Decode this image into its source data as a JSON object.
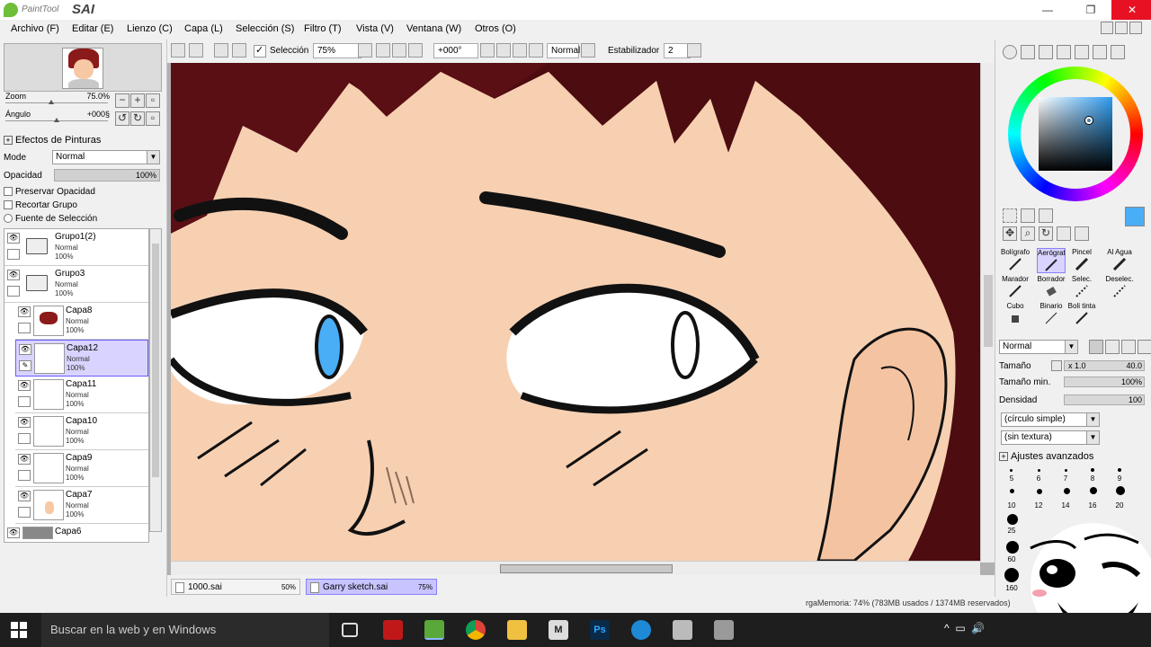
{
  "app": {
    "logo_small": "PaintTool",
    "logo_big": "SAI"
  },
  "window_controls": {
    "minimize": "—",
    "maximize": "❐",
    "close": "✕"
  },
  "menu": [
    "Archivo (F)",
    "Editar (E)",
    "Lienzo (C)",
    "Capa (L)",
    "Selección (S)",
    "Filtro (T)",
    "Vista (V)",
    "Ventana (W)",
    "Otros (O)"
  ],
  "navigator": {
    "zoom_label": "Zoom",
    "zoom_value": "75.0%",
    "angle_label": "Ángulo",
    "angle_value": "+000§"
  },
  "layer_props": {
    "effects_title": "Efectos de Pinturas",
    "mode_label": "Mode",
    "mode_value": "Normal",
    "opacity_label": "Opacidad",
    "opacity_value": "100%",
    "preserve_opacity": "Preservar Opacidad",
    "clip_group": "Recortar Grupo",
    "selection_source": "Fuente de Selección"
  },
  "layers": [
    {
      "name": "Grupo1(2)",
      "mode": "Normal",
      "opacity": "100%",
      "kind": "folder"
    },
    {
      "name": "Grupo3",
      "mode": "Normal",
      "opacity": "100%",
      "kind": "folder"
    },
    {
      "name": "Capa8",
      "mode": "Normal",
      "opacity": "100%",
      "kind": "layer"
    },
    {
      "name": "Capa12",
      "mode": "Normal",
      "opacity": "100%",
      "kind": "layer",
      "selected": true
    },
    {
      "name": "Capa11",
      "mode": "Normal",
      "opacity": "100%",
      "kind": "layer"
    },
    {
      "name": "Capa10",
      "mode": "Normal",
      "opacity": "100%",
      "kind": "layer"
    },
    {
      "name": "Capa9",
      "mode": "Normal",
      "opacity": "100%",
      "kind": "layer"
    },
    {
      "name": "Capa7",
      "mode": "Normal",
      "opacity": "100%",
      "kind": "layer"
    },
    {
      "name": "Capa6",
      "mode": "",
      "opacity": "",
      "kind": "layer"
    }
  ],
  "toolbar": {
    "selection_label": "Selección",
    "zoom_value": "75%",
    "angle_value": "+000°",
    "blend_mode": "Normal",
    "stabilizer_label": "Estabilizador",
    "stabilizer_value": "2"
  },
  "documents": [
    {
      "name": "1000.sai",
      "zoom": "50%",
      "active": false
    },
    {
      "name": "Garry sketch.sai",
      "zoom": "75%",
      "active": true
    }
  ],
  "tools": [
    {
      "label": "Bolígrafo"
    },
    {
      "label": "Aerógraf",
      "selected": true
    },
    {
      "label": "Pincel"
    },
    {
      "label": "Al Agua"
    },
    {
      "label": "Marador"
    },
    {
      "label": "Borrador"
    },
    {
      "label": "Selec."
    },
    {
      "label": "Deselec."
    },
    {
      "label": "Cubo"
    },
    {
      "label": "Binario"
    },
    {
      "label": "Boli tinta"
    }
  ],
  "brush": {
    "mode": "Normal",
    "size_label": "Tamaño",
    "size_mult": "x 1.0",
    "size_value": "40.0",
    "min_size_label": "Tamaño min.",
    "min_size_value": "100%",
    "density_label": "Densidad",
    "density_value": "100",
    "shape": "(círculo simple)",
    "texture": "(sin textura)",
    "advanced": "Ajustes avanzados",
    "sizes": [
      "5",
      "6",
      "7",
      "8",
      "9",
      "10",
      "12",
      "14",
      "16",
      "20",
      "25",
      "60",
      "160"
    ]
  },
  "colors": {
    "current": "#4aaef6",
    "hair": "#8b1a1a",
    "skin": "#f7d0b2"
  },
  "status": {
    "memory": "rgaMemoria: 74% (783MB usados / 1374MB reservados)"
  },
  "taskbar": {
    "search_placeholder": "Buscar en la web y en Windows"
  }
}
